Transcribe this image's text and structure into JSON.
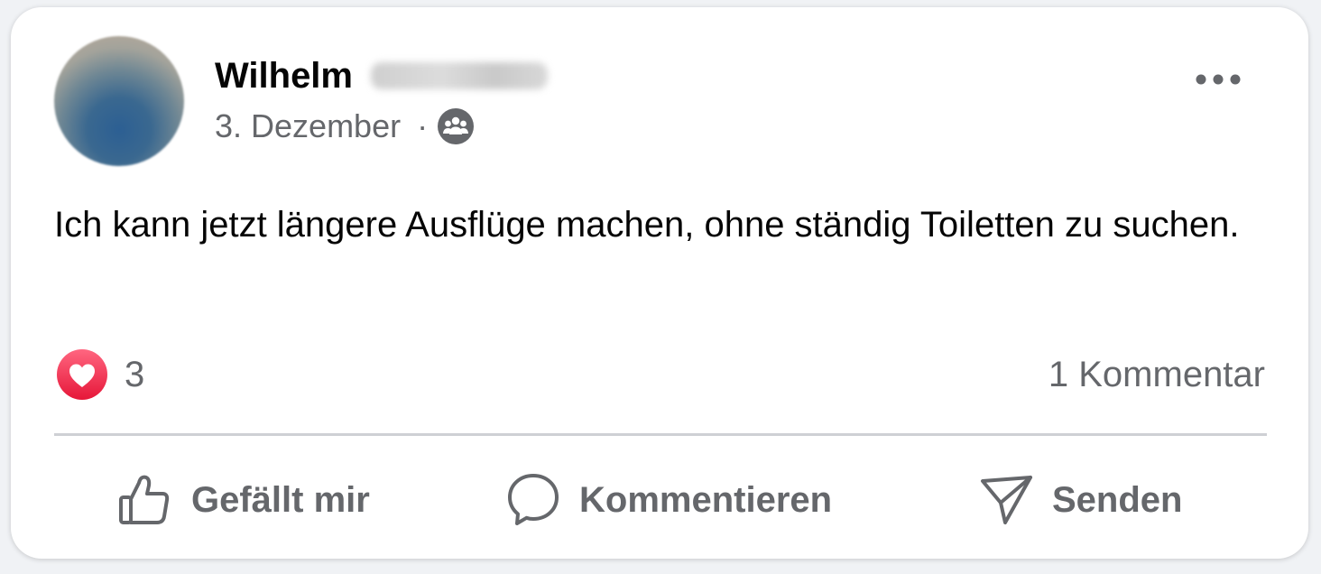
{
  "post": {
    "author_first_name": "Wilhelm",
    "date": "3. Dezember",
    "separator": "·",
    "audience_icon": "group-icon",
    "text": "Ich kann jetzt längere Ausflüge machen, ohne ständig Toiletten zu suchen."
  },
  "stats": {
    "reaction_icon": "love-reaction-icon",
    "reaction_count": "3",
    "comment_count": "1 Kommentar"
  },
  "actions": {
    "like_label": "Gefällt mir",
    "comment_label": "Kommentieren",
    "send_label": "Senden"
  },
  "colors": {
    "text_primary": "#050505",
    "text_secondary": "#65676b",
    "divider": "#ced0d4",
    "love_reaction": "#f33e58"
  }
}
